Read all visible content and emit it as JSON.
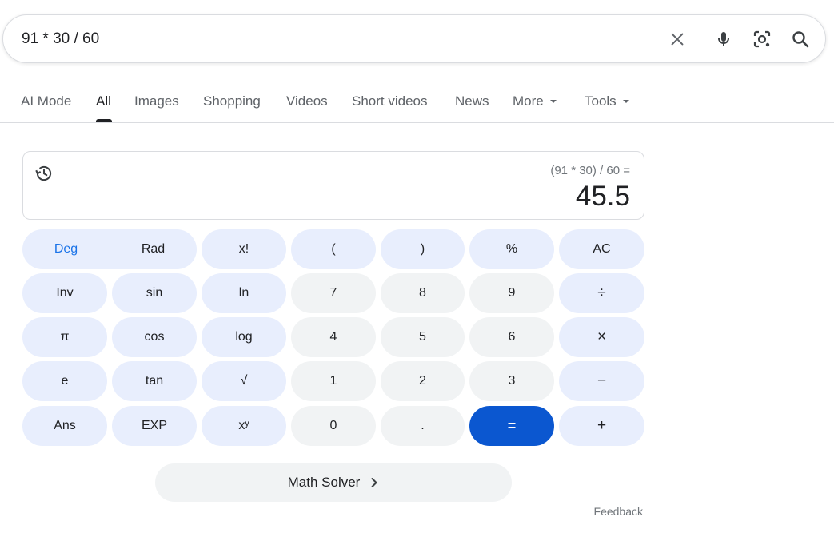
{
  "search": {
    "query": "91 * 30 / 60",
    "icons": {
      "clear": "close-icon",
      "voice": "microphone-icon",
      "lens": "camera-lens-icon",
      "search": "search-icon"
    }
  },
  "tabs": [
    {
      "label": "AI Mode",
      "active": false
    },
    {
      "label": "All",
      "active": true
    },
    {
      "label": "Images",
      "active": false
    },
    {
      "label": "Shopping",
      "active": false
    },
    {
      "label": "Videos",
      "active": false
    },
    {
      "label": "Short videos",
      "active": false
    },
    {
      "label": "News",
      "active": false
    },
    {
      "label": "More",
      "active": false,
      "dropdown": true
    },
    {
      "label": "Tools",
      "active": false,
      "dropdown": true
    }
  ],
  "calculator": {
    "expression": "(91 * 30) / 60 =",
    "result": "45.5",
    "angle_mode": {
      "deg": "Deg",
      "rad": "Rad",
      "selected": "Deg"
    },
    "keys": [
      [
        "x!",
        "(",
        ")",
        "%",
        "AC"
      ],
      [
        "Inv",
        "sin",
        "ln",
        "7",
        "8",
        "9",
        "÷"
      ],
      [
        "π",
        "cos",
        "log",
        "4",
        "5",
        "6",
        "×"
      ],
      [
        "e",
        "tan",
        "√",
        "1",
        "2",
        "3",
        "−"
      ],
      [
        "Ans",
        "EXP",
        "xʸ",
        "0",
        ".",
        "=",
        "+"
      ]
    ]
  },
  "math_solver": {
    "label": "Math Solver"
  },
  "feedback": {
    "label": "Feedback"
  },
  "colors": {
    "accent": "#0b57d0",
    "function_key_bg": "#e8eefd",
    "number_key_bg": "#f1f3f4",
    "deg_text": "#1a73e8"
  }
}
